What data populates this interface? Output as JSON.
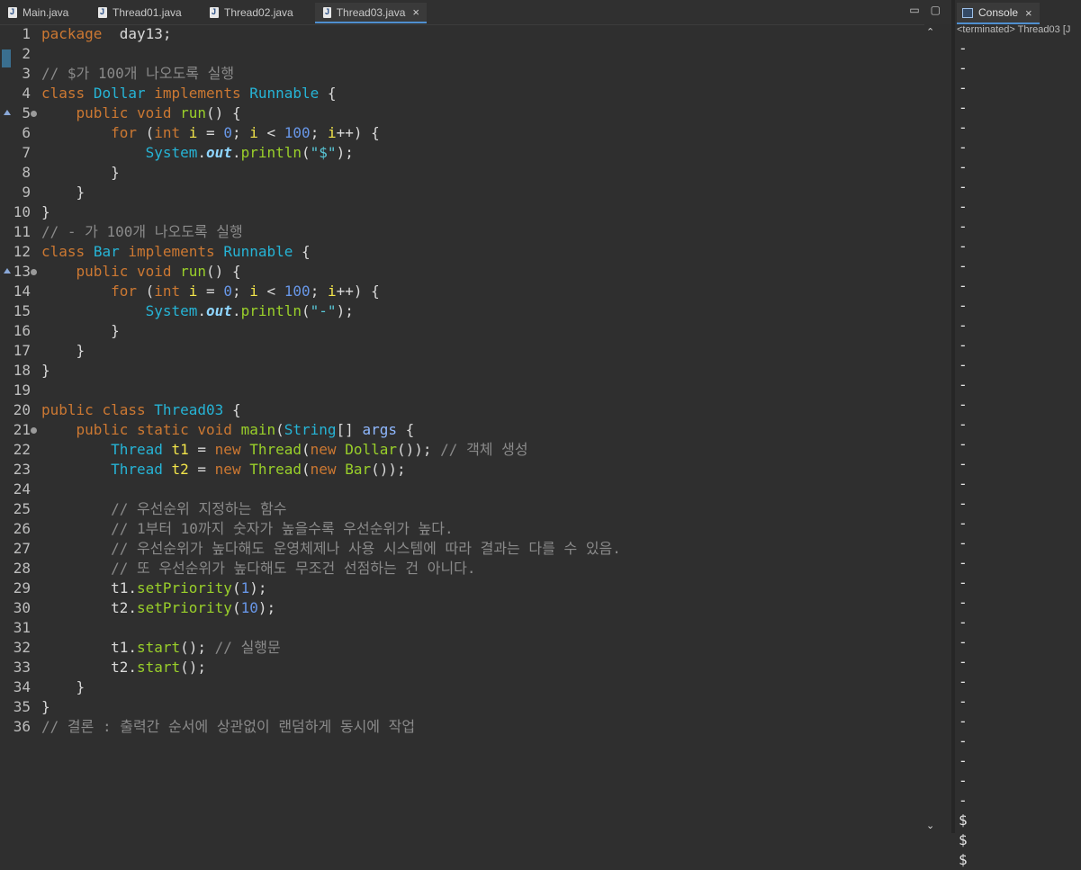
{
  "tabs": [
    {
      "label": "Main.java"
    },
    {
      "label": "Thread01.java"
    },
    {
      "label": "Thread02.java"
    },
    {
      "label": "Thread03.java",
      "active": true
    }
  ],
  "window_controls": {
    "minimize": "▭",
    "maximize": "▢"
  },
  "code_lines": [
    {
      "n": "1",
      "tokens": [
        [
          "kw",
          "package"
        ],
        [
          "",
          "  day13;"
        ]
      ]
    },
    {
      "n": "2",
      "tokens": []
    },
    {
      "n": "3",
      "tokens": [
        [
          "cm",
          "// $가 100개 나오도록 실행"
        ]
      ]
    },
    {
      "n": "4",
      "tokens": [
        [
          "kw",
          "class"
        ],
        [
          "",
          " "
        ],
        [
          "ty",
          "Dollar"
        ],
        [
          "",
          " "
        ],
        [
          "kw",
          "implements"
        ],
        [
          "",
          " "
        ],
        [
          "ty",
          "Runnable"
        ],
        [
          "",
          " {"
        ]
      ]
    },
    {
      "n": "5",
      "fold": true,
      "override": true,
      "tokens": [
        [
          "",
          "    "
        ],
        [
          "kw",
          "public"
        ],
        [
          "",
          " "
        ],
        [
          "kw",
          "void"
        ],
        [
          "",
          " "
        ],
        [
          "mt",
          "run"
        ],
        [
          "",
          "() {"
        ]
      ]
    },
    {
      "n": "6",
      "tokens": [
        [
          "",
          "        "
        ],
        [
          "kw",
          "for"
        ],
        [
          "",
          " ("
        ],
        [
          "kw",
          "int"
        ],
        [
          "",
          " "
        ],
        [
          "var",
          "i"
        ],
        [
          "",
          " = "
        ],
        [
          "num",
          "0"
        ],
        [
          "",
          "; "
        ],
        [
          "var",
          "i"
        ],
        [
          "",
          " < "
        ],
        [
          "num",
          "100"
        ],
        [
          "",
          "; "
        ],
        [
          "var",
          "i"
        ],
        [
          "",
          "++) {"
        ]
      ]
    },
    {
      "n": "7",
      "tokens": [
        [
          "",
          "            "
        ],
        [
          "ty",
          "System"
        ],
        [
          "",
          "."
        ],
        [
          "fld",
          "out"
        ],
        [
          "",
          "."
        ],
        [
          "mt",
          "println"
        ],
        [
          "",
          "("
        ],
        [
          "str",
          "\"$\""
        ],
        [
          "",
          ");"
        ]
      ]
    },
    {
      "n": "8",
      "tokens": [
        [
          "",
          "        }"
        ]
      ]
    },
    {
      "n": "9",
      "tokens": [
        [
          "",
          "    }"
        ]
      ]
    },
    {
      "n": "10",
      "tokens": [
        [
          "",
          "}"
        ]
      ]
    },
    {
      "n": "11",
      "tokens": [
        [
          "cm",
          "// - 가 100개 나오도록 실행"
        ]
      ]
    },
    {
      "n": "12",
      "tokens": [
        [
          "kw",
          "class"
        ],
        [
          "",
          " "
        ],
        [
          "ty",
          "Bar"
        ],
        [
          "",
          " "
        ],
        [
          "kw",
          "implements"
        ],
        [
          "",
          " "
        ],
        [
          "ty",
          "Runnable"
        ],
        [
          "",
          " {"
        ]
      ]
    },
    {
      "n": "13",
      "fold": true,
      "override": true,
      "tokens": [
        [
          "",
          "    "
        ],
        [
          "kw",
          "public"
        ],
        [
          "",
          " "
        ],
        [
          "kw",
          "void"
        ],
        [
          "",
          " "
        ],
        [
          "mt",
          "run"
        ],
        [
          "",
          "() {"
        ]
      ]
    },
    {
      "n": "14",
      "tokens": [
        [
          "",
          "        "
        ],
        [
          "kw",
          "for"
        ],
        [
          "",
          " ("
        ],
        [
          "kw",
          "int"
        ],
        [
          "",
          " "
        ],
        [
          "var",
          "i"
        ],
        [
          "",
          " = "
        ],
        [
          "num",
          "0"
        ],
        [
          "",
          "; "
        ],
        [
          "var",
          "i"
        ],
        [
          "",
          " < "
        ],
        [
          "num",
          "100"
        ],
        [
          "",
          "; "
        ],
        [
          "var",
          "i"
        ],
        [
          "",
          "++) {"
        ]
      ]
    },
    {
      "n": "15",
      "tokens": [
        [
          "",
          "            "
        ],
        [
          "ty",
          "System"
        ],
        [
          "",
          "."
        ],
        [
          "fld",
          "out"
        ],
        [
          "",
          "."
        ],
        [
          "mt",
          "println"
        ],
        [
          "",
          "("
        ],
        [
          "str",
          "\"-\""
        ],
        [
          "",
          ");"
        ]
      ]
    },
    {
      "n": "16",
      "tokens": [
        [
          "",
          "        }"
        ]
      ]
    },
    {
      "n": "17",
      "tokens": [
        [
          "",
          "    }"
        ]
      ]
    },
    {
      "n": "18",
      "tokens": [
        [
          "",
          "}"
        ]
      ]
    },
    {
      "n": "19",
      "tokens": []
    },
    {
      "n": "20",
      "tokens": [
        [
          "kw",
          "public"
        ],
        [
          "",
          " "
        ],
        [
          "kw",
          "class"
        ],
        [
          "",
          " "
        ],
        [
          "ty",
          "Thread03"
        ],
        [
          "",
          " {"
        ]
      ]
    },
    {
      "n": "21",
      "fold": true,
      "tokens": [
        [
          "",
          "    "
        ],
        [
          "kw",
          "public"
        ],
        [
          "",
          " "
        ],
        [
          "kw",
          "static"
        ],
        [
          "",
          " "
        ],
        [
          "kw",
          "void"
        ],
        [
          "",
          " "
        ],
        [
          "mt",
          "main"
        ],
        [
          "",
          "("
        ],
        [
          "ty",
          "String"
        ],
        [
          "",
          "[] "
        ],
        [
          "par",
          "args"
        ],
        [
          "",
          " {"
        ]
      ]
    },
    {
      "n": "22",
      "tokens": [
        [
          "",
          "        "
        ],
        [
          "ty",
          "Thread"
        ],
        [
          "",
          " "
        ],
        [
          "var",
          "t1"
        ],
        [
          "",
          " = "
        ],
        [
          "kw",
          "new"
        ],
        [
          "",
          " "
        ],
        [
          "mt",
          "Thread"
        ],
        [
          "",
          "("
        ],
        [
          "kw",
          "new"
        ],
        [
          "",
          " "
        ],
        [
          "mt",
          "Dollar"
        ],
        [
          "",
          "()); "
        ],
        [
          "cm",
          "// 객체 생성"
        ]
      ]
    },
    {
      "n": "23",
      "tokens": [
        [
          "",
          "        "
        ],
        [
          "ty",
          "Thread"
        ],
        [
          "",
          " "
        ],
        [
          "var",
          "t2"
        ],
        [
          "",
          " = "
        ],
        [
          "kw",
          "new"
        ],
        [
          "",
          " "
        ],
        [
          "mt",
          "Thread"
        ],
        [
          "",
          "("
        ],
        [
          "kw",
          "new"
        ],
        [
          "",
          " "
        ],
        [
          "mt",
          "Bar"
        ],
        [
          "",
          "());"
        ]
      ]
    },
    {
      "n": "24",
      "tokens": []
    },
    {
      "n": "25",
      "tokens": [
        [
          "",
          "        "
        ],
        [
          "cm",
          "// 우선순위 지정하는 함수"
        ]
      ]
    },
    {
      "n": "26",
      "tokens": [
        [
          "",
          "        "
        ],
        [
          "cm",
          "// 1부터 10까지 숫자가 높을수록 우선순위가 높다."
        ]
      ]
    },
    {
      "n": "27",
      "tokens": [
        [
          "",
          "        "
        ],
        [
          "cm",
          "// 우선순위가 높다해도 운영체제나 사용 시스템에 따라 결과는 다를 수 있음."
        ]
      ]
    },
    {
      "n": "28",
      "tokens": [
        [
          "",
          "        "
        ],
        [
          "cm",
          "// 또 우선순위가 높다해도 무조건 선점하는 건 아니다."
        ]
      ]
    },
    {
      "n": "29",
      "tokens": [
        [
          "",
          "        t1."
        ],
        [
          "mt",
          "setPriority"
        ],
        [
          "",
          "("
        ],
        [
          "num",
          "1"
        ],
        [
          "",
          ");"
        ]
      ]
    },
    {
      "n": "30",
      "tokens": [
        [
          "",
          "        t2."
        ],
        [
          "mt",
          "setPriority"
        ],
        [
          "",
          "("
        ],
        [
          "num",
          "10"
        ],
        [
          "",
          ");"
        ]
      ]
    },
    {
      "n": "31",
      "tokens": []
    },
    {
      "n": "32",
      "tokens": [
        [
          "",
          "        t1."
        ],
        [
          "mt",
          "start"
        ],
        [
          "",
          "(); "
        ],
        [
          "cm",
          "// 실행문"
        ]
      ]
    },
    {
      "n": "33",
      "tokens": [
        [
          "",
          "        t2."
        ],
        [
          "mt",
          "start"
        ],
        [
          "",
          "();"
        ]
      ]
    },
    {
      "n": "34",
      "tokens": [
        [
          "",
          "    }"
        ]
      ]
    },
    {
      "n": "35",
      "tokens": [
        [
          "",
          "}"
        ]
      ]
    },
    {
      "n": "36",
      "tokens": [
        [
          "cm",
          "// 결론 : 출력간 순서에 상관없이 랜덤하게 동시에 작업"
        ]
      ]
    }
  ],
  "scrollbar": {
    "up": "⌃",
    "down": "⌄"
  },
  "console": {
    "tab_label": "Console",
    "status": "<terminated> Thread03 [J",
    "output": [
      "-",
      "-",
      "-",
      "-",
      "-",
      "-",
      "-",
      "-",
      "-",
      "-",
      "-",
      "-",
      "-",
      "-",
      "-",
      "-",
      "-",
      "-",
      "-",
      "-",
      "-",
      "-",
      "-",
      "-",
      "-",
      "-",
      "-",
      "-",
      "-",
      "-",
      "-",
      "-",
      "-",
      "-",
      "-",
      "-",
      "-",
      "-",
      "-",
      "$",
      "$",
      "$"
    ]
  },
  "colors": {
    "background": "#2f2f2f",
    "keyword": "#cc7832",
    "type": "#26b4d6",
    "method": "#9ad02a",
    "comment": "#8a8a8a",
    "number": "#6897e8",
    "accent": "#4f8fd0"
  }
}
